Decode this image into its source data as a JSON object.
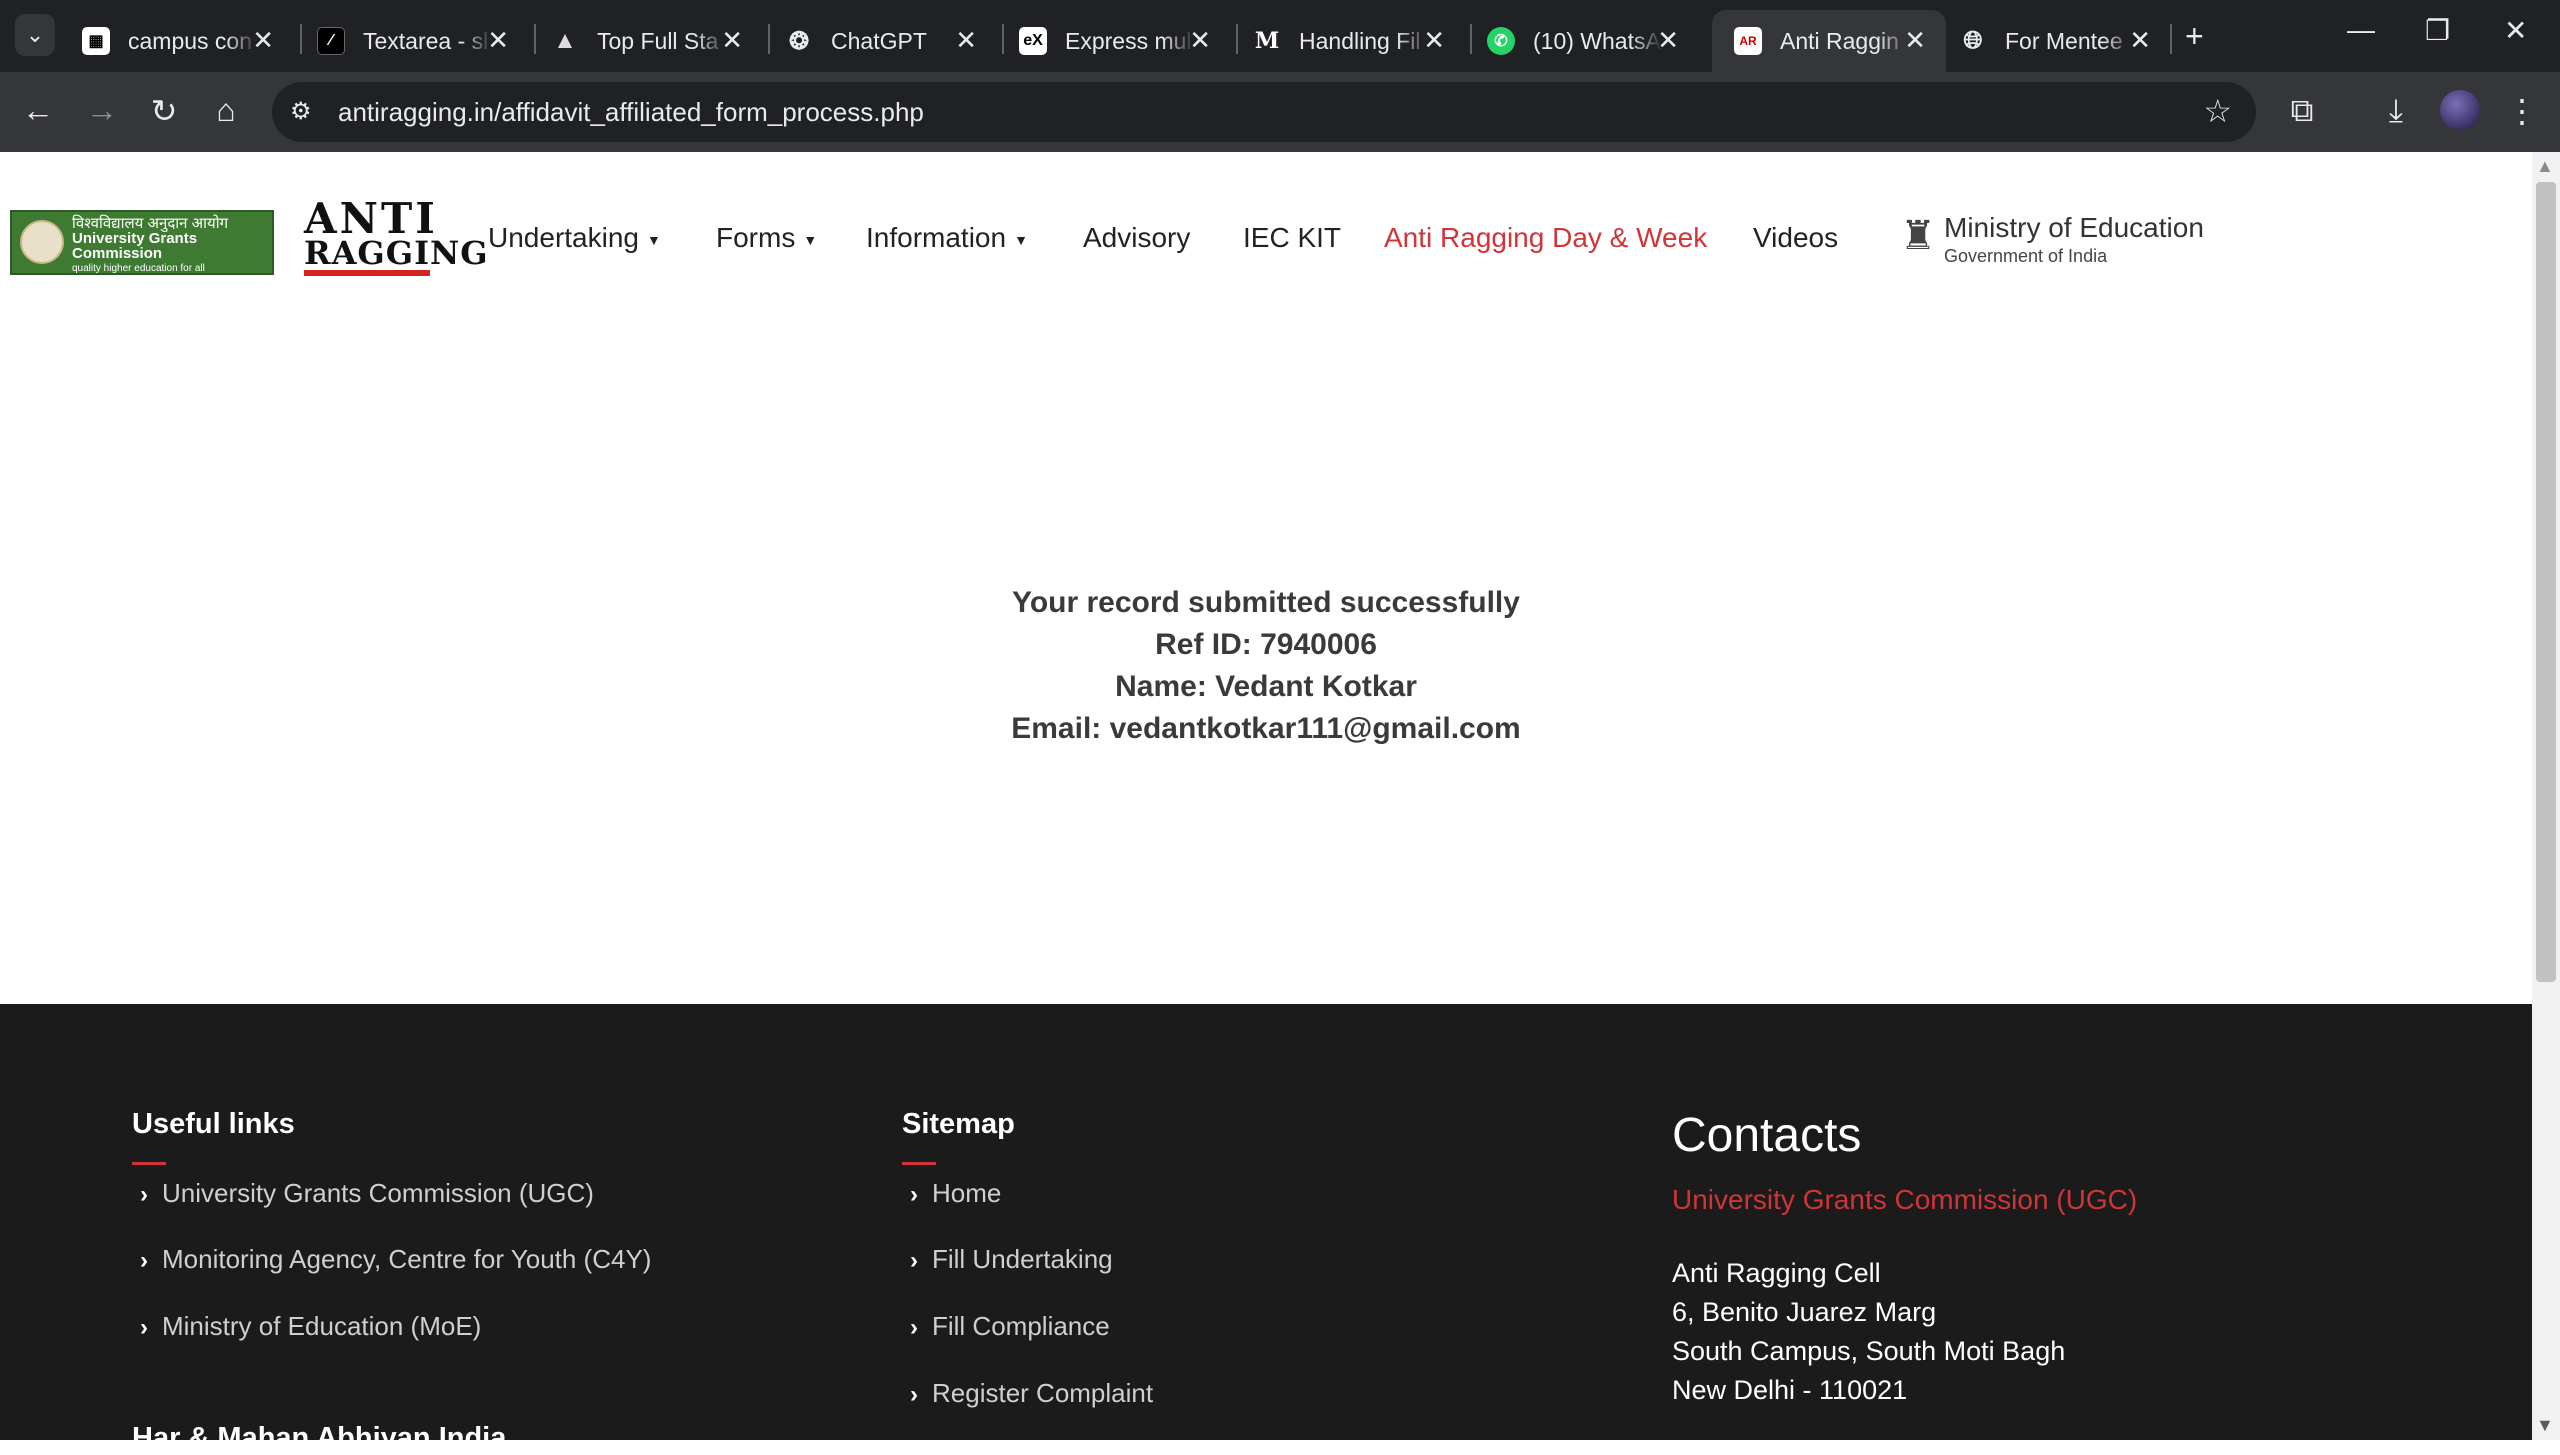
{
  "browser": {
    "tabs": [
      {
        "title": "campus con",
        "icon": "campus-icon"
      },
      {
        "title": "Textarea - sl",
        "icon": "textarea-icon"
      },
      {
        "title": "Top Full Sta",
        "icon": "mountain-icon"
      },
      {
        "title": "ChatGPT",
        "icon": "chatgpt-icon"
      },
      {
        "title": "Express mul",
        "icon": "express-icon"
      },
      {
        "title": "Handling Fil",
        "icon": "medium-icon"
      },
      {
        "title": "(10) WhatsA",
        "icon": "whatsapp-icon"
      },
      {
        "title": "Anti Raggin",
        "icon": "antiragging-icon"
      },
      {
        "title": "For Mentee",
        "icon": "globe-icon"
      }
    ],
    "active_tab_index": 7,
    "url": "antiragging.in/affidavit_affiliated_form_process.php"
  },
  "header": {
    "ugc_logo": {
      "hindi": "विश्वविद्यालय अनुदान आयोग",
      "english": "University Grants Commission",
      "tagline": "quality higher education for all"
    },
    "anti_logo": {
      "line1": "ANTI",
      "line2": "RAGGING"
    },
    "nav": [
      {
        "label": "Undertaking",
        "dropdown": true
      },
      {
        "label": "Forms",
        "dropdown": true
      },
      {
        "label": "Information",
        "dropdown": true
      },
      {
        "label": "Advisory",
        "dropdown": false
      },
      {
        "label": "IEC KIT",
        "dropdown": false
      },
      {
        "label": "Anti Ragging Day & Week",
        "dropdown": false,
        "highlight": true
      },
      {
        "label": "Videos",
        "dropdown": false
      }
    ],
    "moe": {
      "title": "Ministry of Education",
      "subtitle": "Government of India"
    }
  },
  "message": {
    "line1": "Your record submitted successfully",
    "ref": "Ref ID: 7940006",
    "name": "Name: Vedant Kotkar",
    "email": "Email: vedantkotkar111@gmail.com"
  },
  "footer": {
    "useful_links": {
      "title": "Useful links",
      "items": [
        "University Grants Commission (UGC)",
        "Monitoring Agency, Centre for Youth (C4Y)",
        "Ministry of Education (MoE)"
      ]
    },
    "sitemap": {
      "title": "Sitemap",
      "items": [
        "Home",
        "Fill Undertaking",
        "Fill Compliance",
        "Register Complaint"
      ]
    },
    "contacts": {
      "title": "Contacts",
      "org": "University Grants Commission (UGC)",
      "address": [
        "Anti Ragging Cell",
        "6, Benito Juarez Marg",
        "South Campus, South Moti Bagh",
        "New Delhi - 110021"
      ]
    },
    "next_section_title": "Har & Mahan Abhiyan India"
  },
  "colors": {
    "accent_red": "#d13438",
    "footer_bg": "#1b1b1b",
    "ugc_green": "#3e7a32"
  }
}
